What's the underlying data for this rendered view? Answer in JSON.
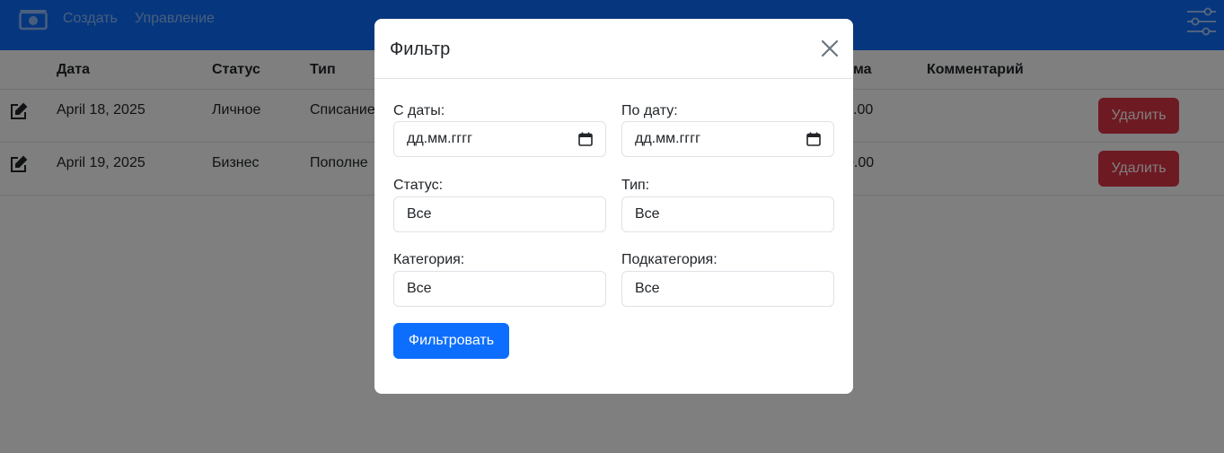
{
  "navbar": {
    "brand_icon": "cash-icon",
    "create_label": "Создать",
    "manage_label": "Управление",
    "filter_icon": "sliders-icon"
  },
  "table": {
    "headers": {
      "date": "Дата",
      "status": "Статус",
      "type": "Тип",
      "amount_partial": "ма",
      "comment": "Комментарий"
    },
    "rows": [
      {
        "date": "April 18, 2025",
        "status": "Личное",
        "type": "Списание",
        "amount_partial": ".00",
        "delete_label": "Удалить"
      },
      {
        "date": "April 19, 2025",
        "status": "Бизнес",
        "type": "Пополне",
        "amount_partial": "0.00",
        "delete_label": "Удалить"
      }
    ]
  },
  "modal": {
    "title": "Фильтр",
    "from_date_label": "С даты:",
    "from_date_placeholder": "дд.мм.гггг",
    "to_date_label": "По дату:",
    "to_date_placeholder": "дд.мм.гггг",
    "status_label": "Статус:",
    "status_value": "Все",
    "type_label": "Тип:",
    "type_value": "Все",
    "category_label": "Категория:",
    "category_value": "Все",
    "subcategory_label": "Подкатегория:",
    "subcategory_value": "Все",
    "submit_label": "Фильтровать"
  },
  "colors": {
    "primary": "#0d6efd",
    "danger": "#dc3545",
    "backdrop": "rgba(0,0,0,0.5)"
  }
}
